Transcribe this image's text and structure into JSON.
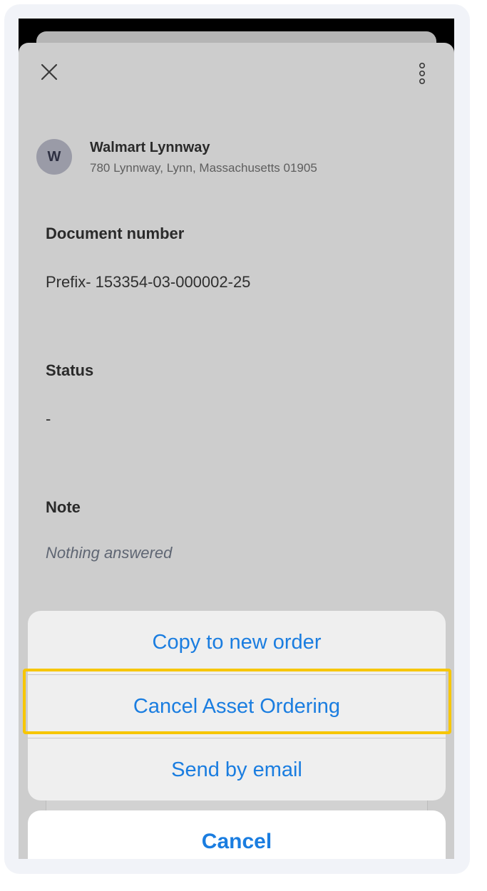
{
  "header": {
    "close_icon": "close-icon",
    "more_icon": "more-vertical-icon"
  },
  "store": {
    "avatar_letter": "W",
    "name": "Walmart Lynnway",
    "address": "780 Lynnway, Lynn, Massachusetts 01905"
  },
  "fields": {
    "document_number_label": "Document number",
    "document_number_value": "Prefix- 153354-03-000002-25",
    "status_label": "Status",
    "status_value": "-",
    "note_label": "Note",
    "note_value": "Nothing answered"
  },
  "action_sheet": {
    "items": [
      {
        "label": "Copy to new order"
      },
      {
        "label": "Cancel Asset Ordering"
      },
      {
        "label": "Send by email"
      }
    ],
    "cancel_label": "Cancel",
    "accent_color": "#1a7de0",
    "highlight_color": "#f7c600"
  }
}
